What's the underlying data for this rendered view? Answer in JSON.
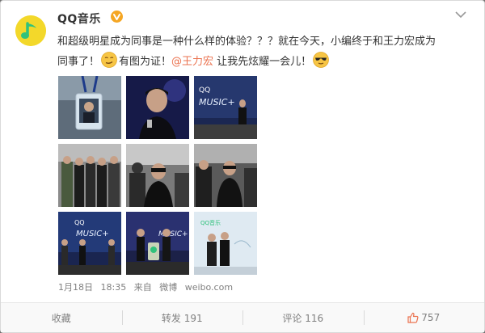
{
  "post": {
    "user_name": "QQ音乐",
    "text_1": "和超级明星成为同事是一种什么样的体验？？？就在今天，小编终于和王力宏成为",
    "text_2": "同事了！",
    "text_3": "有图为证！",
    "mention": "@王力宏",
    "text_4": " 让我先炫耀一会儿！",
    "date": "1月18日",
    "time": "18:35",
    "source_prefix": "来自",
    "source": "微博",
    "source_url": "weibo.com"
  },
  "actions": {
    "favorite": "收藏",
    "repost": "转发 191",
    "comment": "评论 116",
    "like_count": "757"
  },
  "icons": [
    "qq-music-logo-icon",
    "verified-icon",
    "chevron-down-icon",
    "smirk-emoji-icon",
    "cool-emoji-icon",
    "thumbs-up-icon"
  ],
  "colors": {
    "mention": "#eb7350",
    "verified": "#f5a623",
    "like": "#eb7350",
    "avatar_bg": "#f3d82a",
    "logo_green": "#31c27c"
  }
}
